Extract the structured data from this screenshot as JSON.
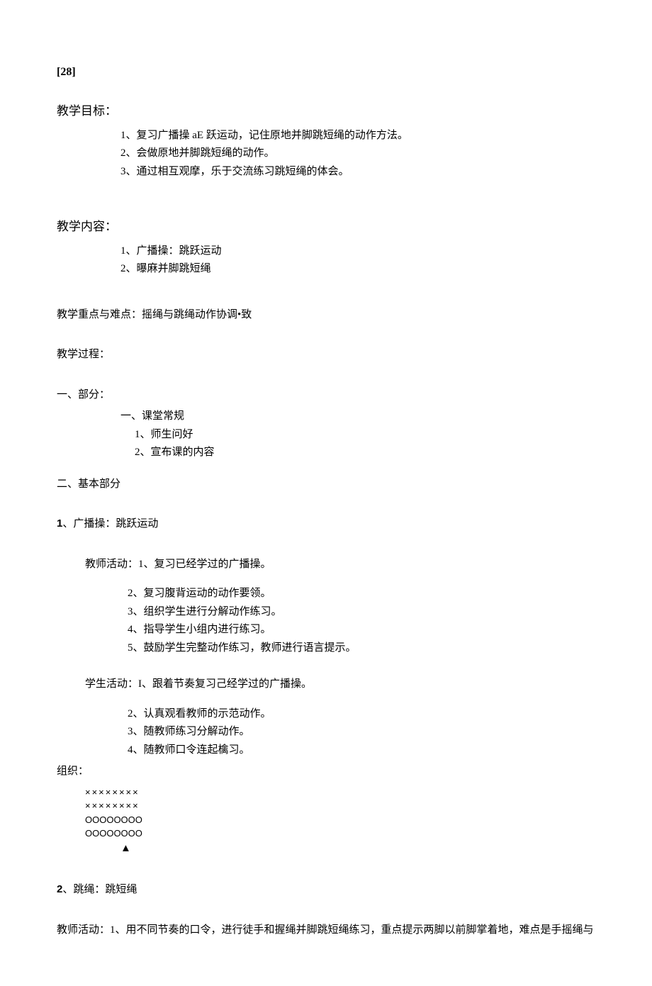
{
  "pageNumber": "[28]",
  "headers": {
    "goals": "教学目标：",
    "contents": "教学内容：",
    "focus_label": "教学重点与难点：",
    "focus_value": "摇绳与跳绳动作协调•致",
    "process": "教学过程：",
    "part1": "一、部分：",
    "part1_sub": "一、课堂常规",
    "part2": "二、基本部分",
    "item1_title": "1、广播操：跳跃运动",
    "teacher_label": "教师活动：",
    "teacher_first": "1、复习已经学过的广播操。",
    "student_label": "学生活动：",
    "student_first": "I、跟着节奏复习己经学过的广播操。",
    "organization": "组织：",
    "item2_title": "2、跳绳：跳短绳",
    "teacher2_label": "教师活动：",
    "teacher2_first": "1、用不同节奏的口令，进行徒手和握绳并脚跳短绳练习，重点提示两脚以前脚掌着地，难点是手摇绳与"
  },
  "goals": [
    "1、复习广播操 aE 跃运动，记住原地并脚跳短绳的动作方法。",
    "2、会做原地并脚跳短绳的动作。",
    "3、通过相互观摩，乐于交流练习跳短绳的体会。"
  ],
  "contents": [
    "1、广播操：跳跃运动",
    "2、曝麻并脚跳短绳"
  ],
  "routine": [
    "1、师生问好",
    "2、宣布课的内容"
  ],
  "teacher_acts": [
    "2、复习腹背运动的动作要领。",
    "3、组织学生进行分解动作练习。",
    "4、指导学生小组内进行练习。",
    "5、鼓励学生完整动作练习，教师进行语言提示。"
  ],
  "student_acts": [
    "2、认真观看教师的示范动作。",
    "3、随教师练习分解动作。",
    "4、随教师口令连起檎习。"
  ],
  "org_rows": {
    "x1": "××××××××",
    "x2": "××××××××",
    "o1": "OOOOOOOO",
    "o2": "OOOOOOOO",
    "t": "▲"
  }
}
